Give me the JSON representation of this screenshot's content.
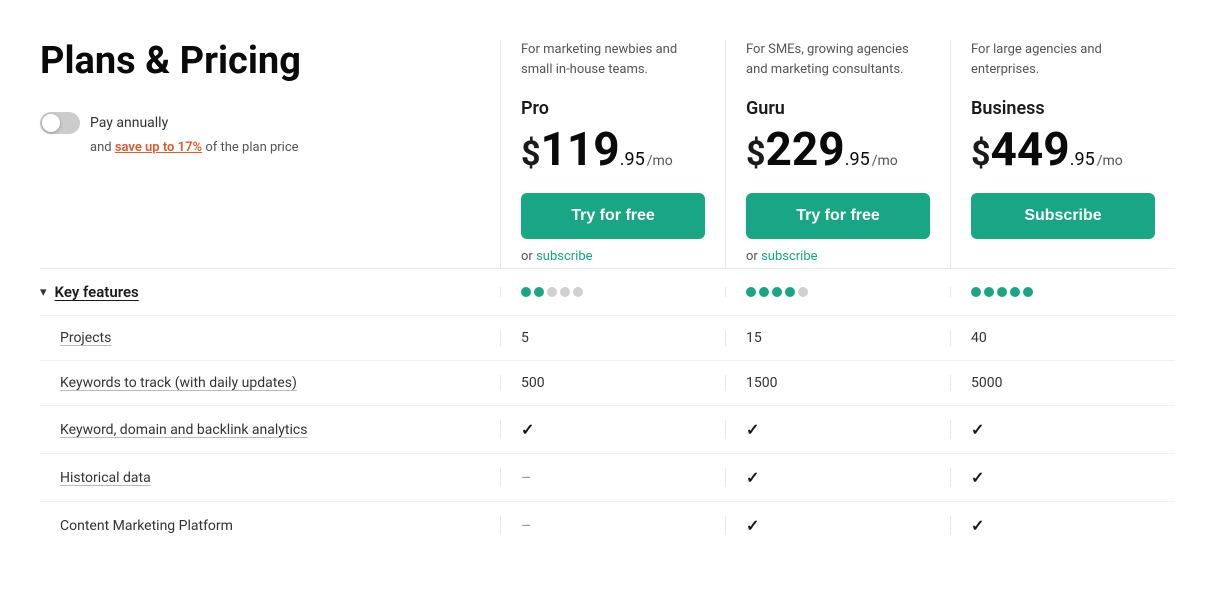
{
  "page": {
    "title": "Plans & Pricing",
    "billing": {
      "toggle_label": "Pay annually",
      "save_text": "and",
      "save_highlight": "save up to 17%",
      "save_suffix": "of the plan price"
    },
    "plans": [
      {
        "id": "pro",
        "subtitle": "For marketing newbies and small in-house teams.",
        "name": "Pro",
        "price_symbol": "$",
        "price_main": "119",
        "price_cents": ".95",
        "price_period": "/mo",
        "cta_label": "Try for free",
        "or_text": "or",
        "subscribe_link_text": "subscribe",
        "dots_filled": 2,
        "dots_empty": 3,
        "total_dots": 5,
        "projects": "5",
        "keywords": "500",
        "analytics": "✓",
        "historical": "–",
        "content_marketing": "–"
      },
      {
        "id": "guru",
        "subtitle": "For SMEs, growing agencies and marketing consultants.",
        "name": "Guru",
        "price_symbol": "$",
        "price_main": "229",
        "price_cents": ".95",
        "price_period": "/mo",
        "cta_label": "Try for free",
        "or_text": "or",
        "subscribe_link_text": "subscribe",
        "dots_filled": 4,
        "dots_empty": 1,
        "total_dots": 5,
        "projects": "15",
        "keywords": "1500",
        "analytics": "✓",
        "historical": "✓",
        "content_marketing": "✓"
      },
      {
        "id": "business",
        "subtitle": "For large agencies and enterprises.",
        "name": "Business",
        "price_symbol": "$",
        "price_main": "449",
        "price_cents": ".95",
        "price_period": "/mo",
        "cta_label": "Subscribe",
        "dots_filled": 5,
        "dots_empty": 0,
        "total_dots": 5,
        "projects": "40",
        "keywords": "5000",
        "analytics": "✓",
        "historical": "✓",
        "content_marketing": "✓"
      }
    ],
    "features": {
      "section_label": "Key features",
      "rows": [
        {
          "label": "Projects",
          "underline": true
        },
        {
          "label": "Keywords to track (with daily updates)",
          "underline": true
        },
        {
          "label": "Keyword, domain and backlink analytics",
          "underline": true
        },
        {
          "label": "Historical data",
          "underline": true
        },
        {
          "label": "Content Marketing Platform",
          "underline": false
        }
      ]
    }
  }
}
